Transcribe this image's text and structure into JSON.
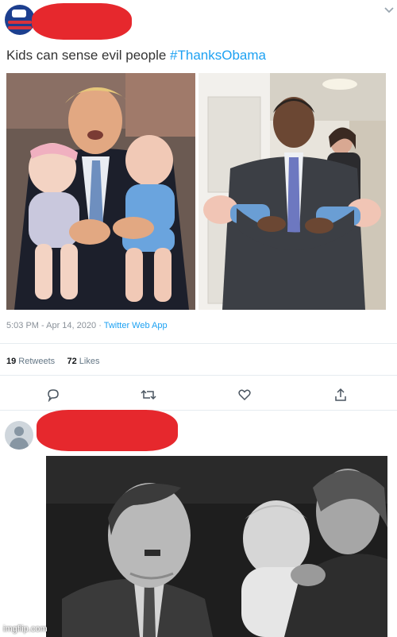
{
  "tweet1": {
    "text": "Kids can sense evil people ",
    "hashtag": "#ThanksObama",
    "time": "5:03 PM - Apr 14, 2020",
    "separator": " · ",
    "app": "Twitter Web App",
    "retweets_count": "19",
    "retweets_label": " Retweets",
    "likes_count": "72",
    "likes_label": " Likes"
  },
  "actions": [
    "reply-icon",
    "retweet-icon",
    "like-icon",
    "share-icon"
  ],
  "watermark": "imgflip.com",
  "colors": {
    "redaction": "#e6282d",
    "link": "#1da1f2",
    "muted": "#8a9199"
  }
}
